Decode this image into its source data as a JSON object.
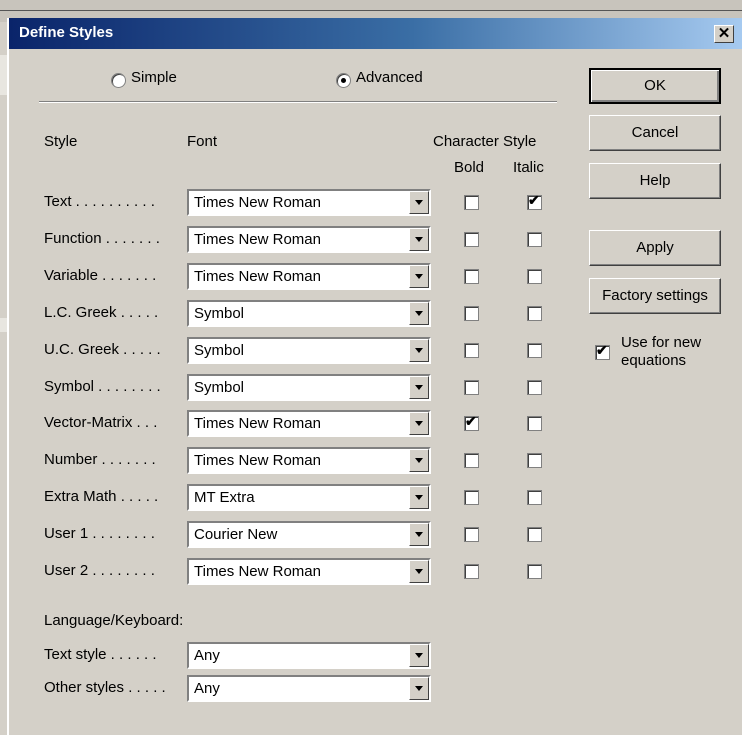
{
  "window": {
    "title": "Define Styles",
    "close_label": "✕"
  },
  "mode": {
    "simple_label": "Simple",
    "advanced_label": "Advanced",
    "selected": "Advanced"
  },
  "headers": {
    "style": "Style",
    "font": "Font",
    "character_style": "Character Style",
    "bold": "Bold",
    "italic": "Italic"
  },
  "styles": [
    {
      "label": "Text . . . . . . . . . .",
      "font": "Times New Roman",
      "bold": false,
      "italic": true
    },
    {
      "label": "Function . . . . . . .",
      "font": "Times New Roman",
      "bold": false,
      "italic": false
    },
    {
      "label": "Variable . . . . . . .",
      "font": "Times New Roman",
      "bold": false,
      "italic": false
    },
    {
      "label": "L.C. Greek . . . . .",
      "font": "Symbol",
      "bold": false,
      "italic": false
    },
    {
      "label": "U.C. Greek . . . . .",
      "font": "Symbol",
      "bold": false,
      "italic": false
    },
    {
      "label": "Symbol . . . . . . . .",
      "font": "Symbol",
      "bold": false,
      "italic": false
    },
    {
      "label": "Vector-Matrix . . .",
      "font": "Times New Roman",
      "bold": true,
      "italic": false
    },
    {
      "label": "Number . . . . . . .",
      "font": "Times New Roman",
      "bold": false,
      "italic": false
    },
    {
      "label": "Extra Math . . . . .",
      "font": "MT Extra",
      "bold": false,
      "italic": false
    },
    {
      "label": "User 1 . . . . . . . .",
      "font": "Courier New",
      "bold": false,
      "italic": false
    },
    {
      "label": "User 2 . . . . . . . .",
      "font": "Times New Roman",
      "bold": false,
      "italic": false
    }
  ],
  "language": {
    "heading": "Language/Keyboard:",
    "rows": [
      {
        "label": "Text style . . . . . .",
        "value": "Any"
      },
      {
        "label": "Other styles . . . . .",
        "value": "Any"
      }
    ]
  },
  "buttons": {
    "ok": "OK",
    "cancel": "Cancel",
    "help": "Help",
    "apply": "Apply",
    "factory": "Factory settings"
  },
  "use_for_new": {
    "checked": true,
    "line1": "Use for new",
    "line2": "equations"
  }
}
